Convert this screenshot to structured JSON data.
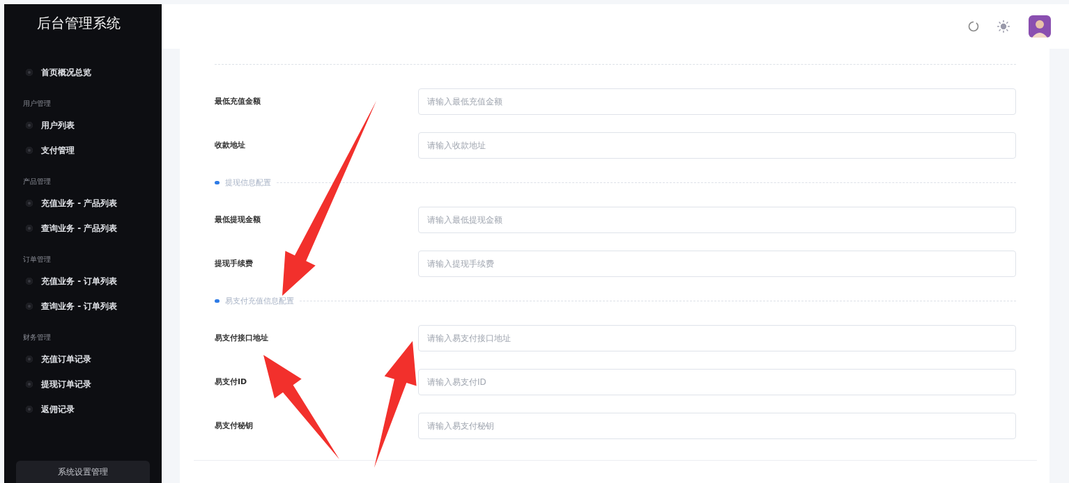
{
  "sidebar": {
    "title": "后台管理系统",
    "groups": [
      {
        "items": [
          {
            "label": "首页概况总览",
            "selected": false
          }
        ]
      },
      {
        "label": "用户管理",
        "items": [
          {
            "label": "用户列表",
            "selected": false
          },
          {
            "label": "支付管理",
            "selected": false
          }
        ]
      },
      {
        "label": "产品管理",
        "items": [
          {
            "label": "充值业务 - 产品列表",
            "selected": false
          },
          {
            "label": "查询业务 - 产品列表",
            "selected": false
          }
        ]
      },
      {
        "label": "订单管理",
        "items": [
          {
            "label": "充值业务 - 订单列表",
            "selected": false
          },
          {
            "label": "查询业务 - 订单列表",
            "selected": false
          }
        ]
      },
      {
        "label": "财务管理",
        "items": [
          {
            "label": "充值订单记录",
            "selected": false
          },
          {
            "label": "提现订单记录",
            "selected": false
          },
          {
            "label": "返佣记录",
            "selected": false
          }
        ]
      }
    ],
    "footer_button": "系统设置管理"
  },
  "form": [
    {
      "kind": "divider"
    },
    {
      "kind": "field",
      "label": "最低充值金额",
      "placeholder": "请输入最低充值金额"
    },
    {
      "kind": "field",
      "label": "收款地址",
      "placeholder": "请输入收款地址"
    },
    {
      "kind": "section",
      "title": "提现信息配置"
    },
    {
      "kind": "field",
      "label": "最低提现金额",
      "placeholder": "请输入最低提现金额"
    },
    {
      "kind": "field",
      "label": "提现手续费",
      "placeholder": "请输入提现手续费"
    },
    {
      "kind": "section",
      "title": "易支付充值信息配置"
    },
    {
      "kind": "field",
      "label": "易支付接口地址",
      "placeholder": "请输入易支付接口地址"
    },
    {
      "kind": "field",
      "label": "易支付ID",
      "placeholder": "请输入易支付ID"
    },
    {
      "kind": "field",
      "label": "易支付秘钥",
      "placeholder": "请输入易支付秘钥"
    }
  ]
}
